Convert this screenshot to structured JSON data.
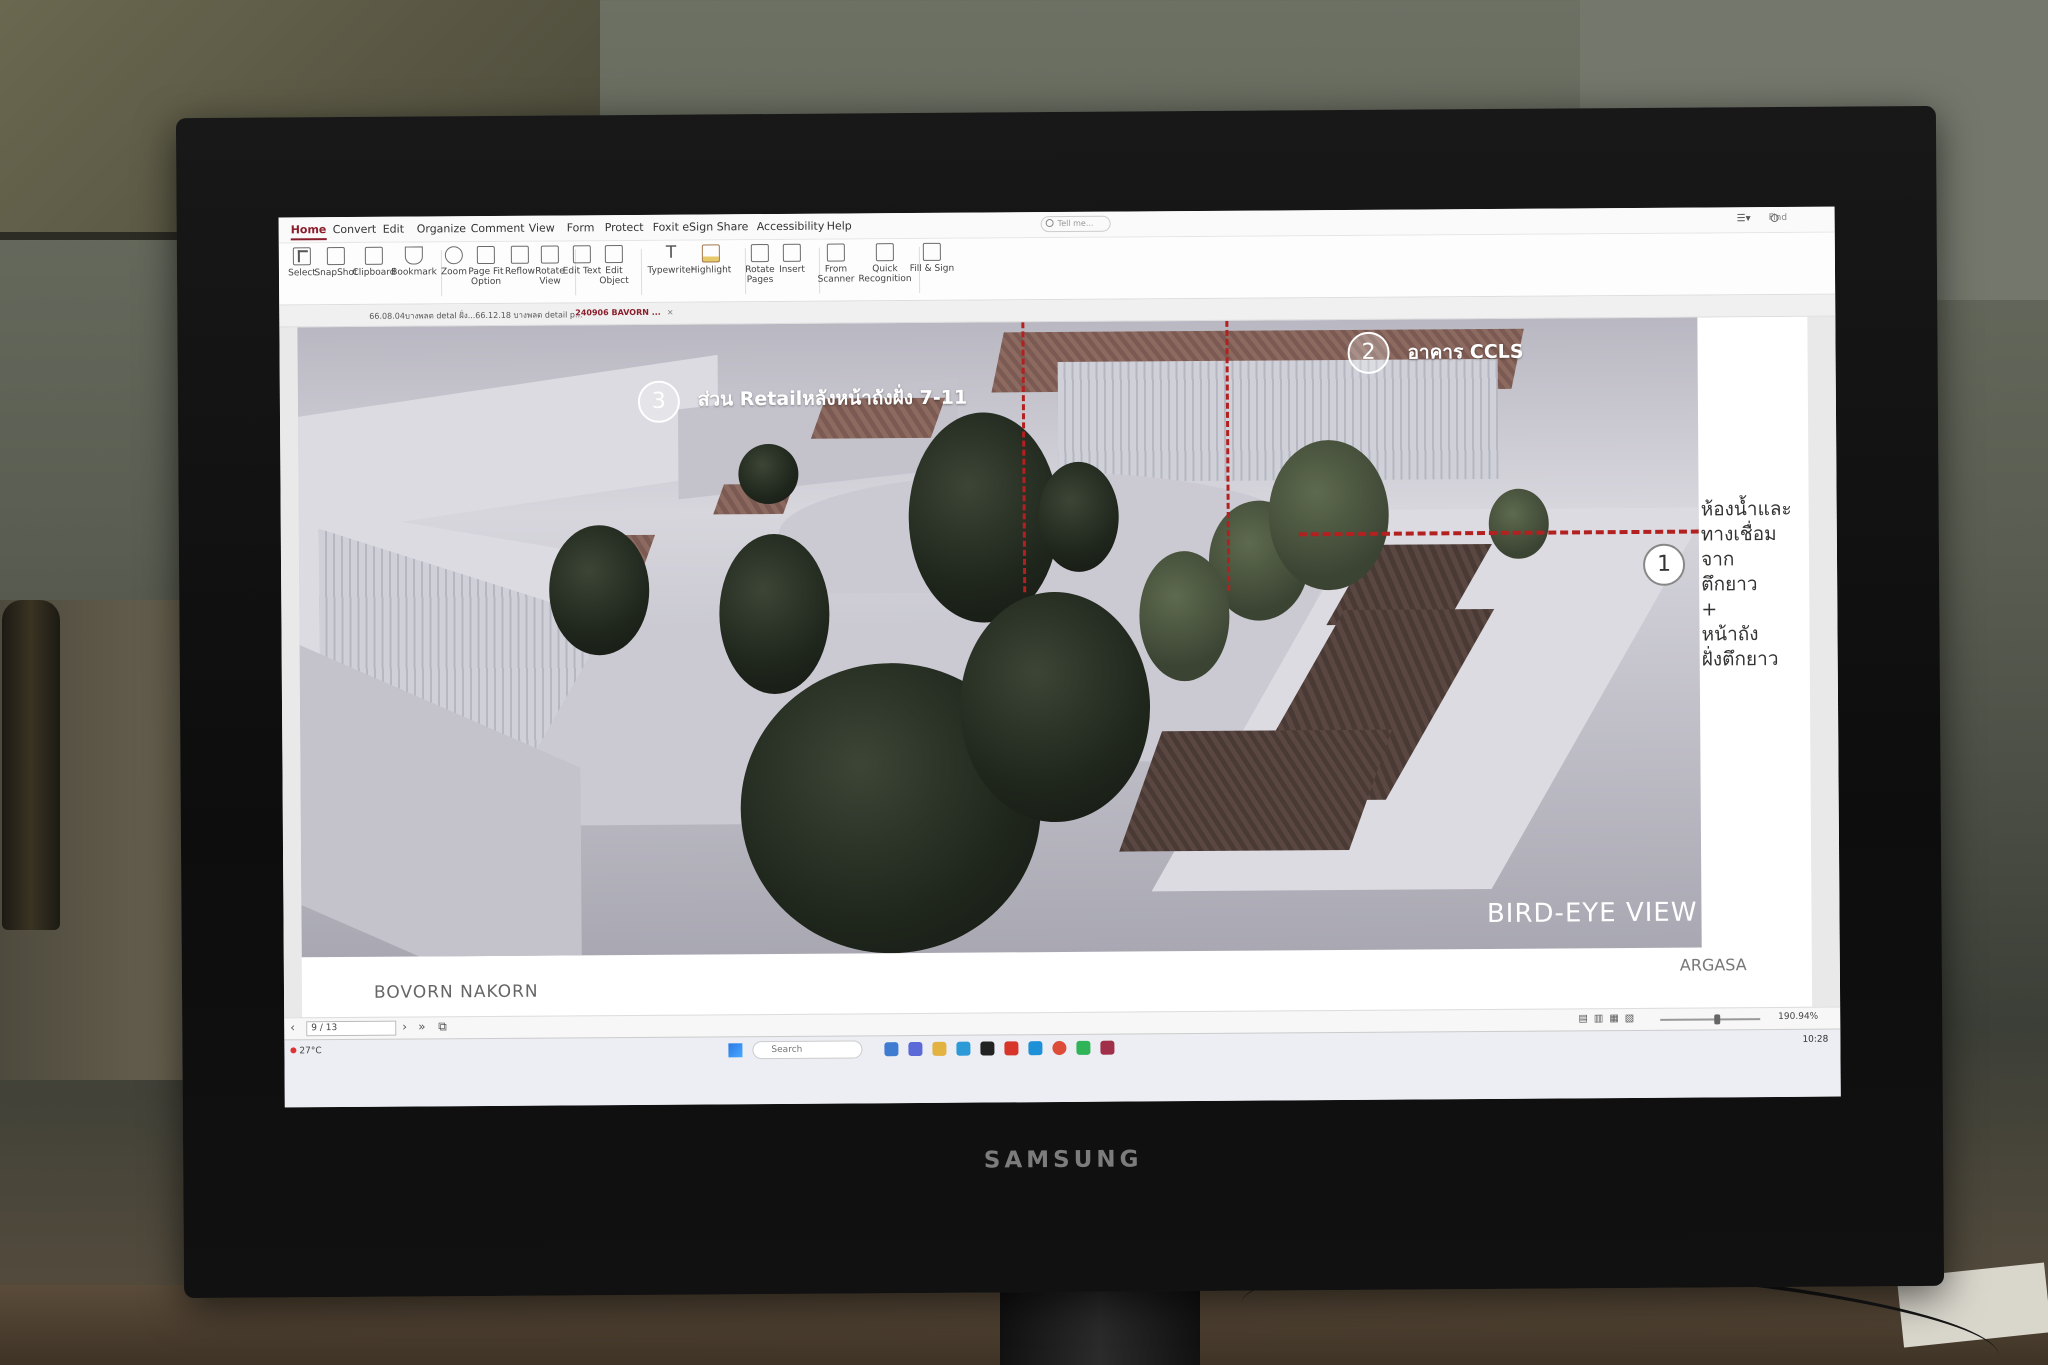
{
  "monitor": {
    "brand": "SAMSUNG"
  },
  "ribbon_tabs": [
    "Home",
    "Convert",
    "Edit",
    "Organize",
    "Comment",
    "View",
    "Form",
    "Protect",
    "Foxit eSign",
    "Share",
    "Accessibility",
    "Help"
  ],
  "tell_me": "Tell me...",
  "find": "Find",
  "tools": [
    {
      "label": "Select",
      "icon": "select-icon"
    },
    {
      "label": "SnapShot",
      "icon": "snapshot-icon"
    },
    {
      "label": "Clipboard",
      "icon": "clipboard-icon"
    },
    {
      "label": "Bookmark",
      "icon": "bookmark-icon"
    },
    {
      "label": "Zoom",
      "icon": "zoom-icon"
    },
    {
      "label": "Page Fit Option",
      "icon": "page-fit-icon"
    },
    {
      "label": "Reflow",
      "icon": "reflow-icon"
    },
    {
      "label": "Rotate View",
      "icon": "rotate-view-icon"
    },
    {
      "label": "Edit Text",
      "icon": "edit-text-icon"
    },
    {
      "label": "Edit Object",
      "icon": "edit-object-icon"
    },
    {
      "label": "Typewriter",
      "icon": "typewriter-icon"
    },
    {
      "label": "Highlight",
      "icon": "highlight-icon"
    },
    {
      "label": "Rotate Pages",
      "icon": "rotate-pages-icon"
    },
    {
      "label": "Insert",
      "icon": "insert-icon"
    },
    {
      "label": "From Scanner",
      "icon": "scanner-icon"
    },
    {
      "label": "Quick Recognition",
      "icon": "ocr-icon"
    },
    {
      "label": "Fill & Sign",
      "icon": "fill-sign-icon"
    }
  ],
  "doc_tabs": [
    {
      "title": "66.08.04บางพลต detal ฝั่ง...",
      "active": false
    },
    {
      "title": "66.12.18 บางพลต detail p...",
      "active": false
    },
    {
      "title": "240906 BAVORN ...",
      "active": true
    }
  ],
  "page": {
    "markers": [
      {
        "num": "3",
        "caption": "ส่วน Retailหลังหน้าถังฝั่ง 7-11"
      },
      {
        "num": "2",
        "caption": "อาคาร CCLS"
      },
      {
        "num": "1",
        "caption": ""
      }
    ],
    "side_note": "ห้องน้ำและ\nทางเชื่อมจาก\nตึกยาว\n+\nหน้าถัง\nฝั่งตึกยาว",
    "view_label": "BIRD-EYE VIEW",
    "footer_left": "BOVORN NAKORN",
    "footer_right": "ARGASA"
  },
  "status": {
    "page_indicator": "9 / 13",
    "zoom": "190.94%"
  },
  "taskbar": {
    "weather": "27°C",
    "search": "Search",
    "time": "10:28"
  },
  "colors": {
    "accent": "#8b1e2b",
    "redline": "#b32020"
  }
}
